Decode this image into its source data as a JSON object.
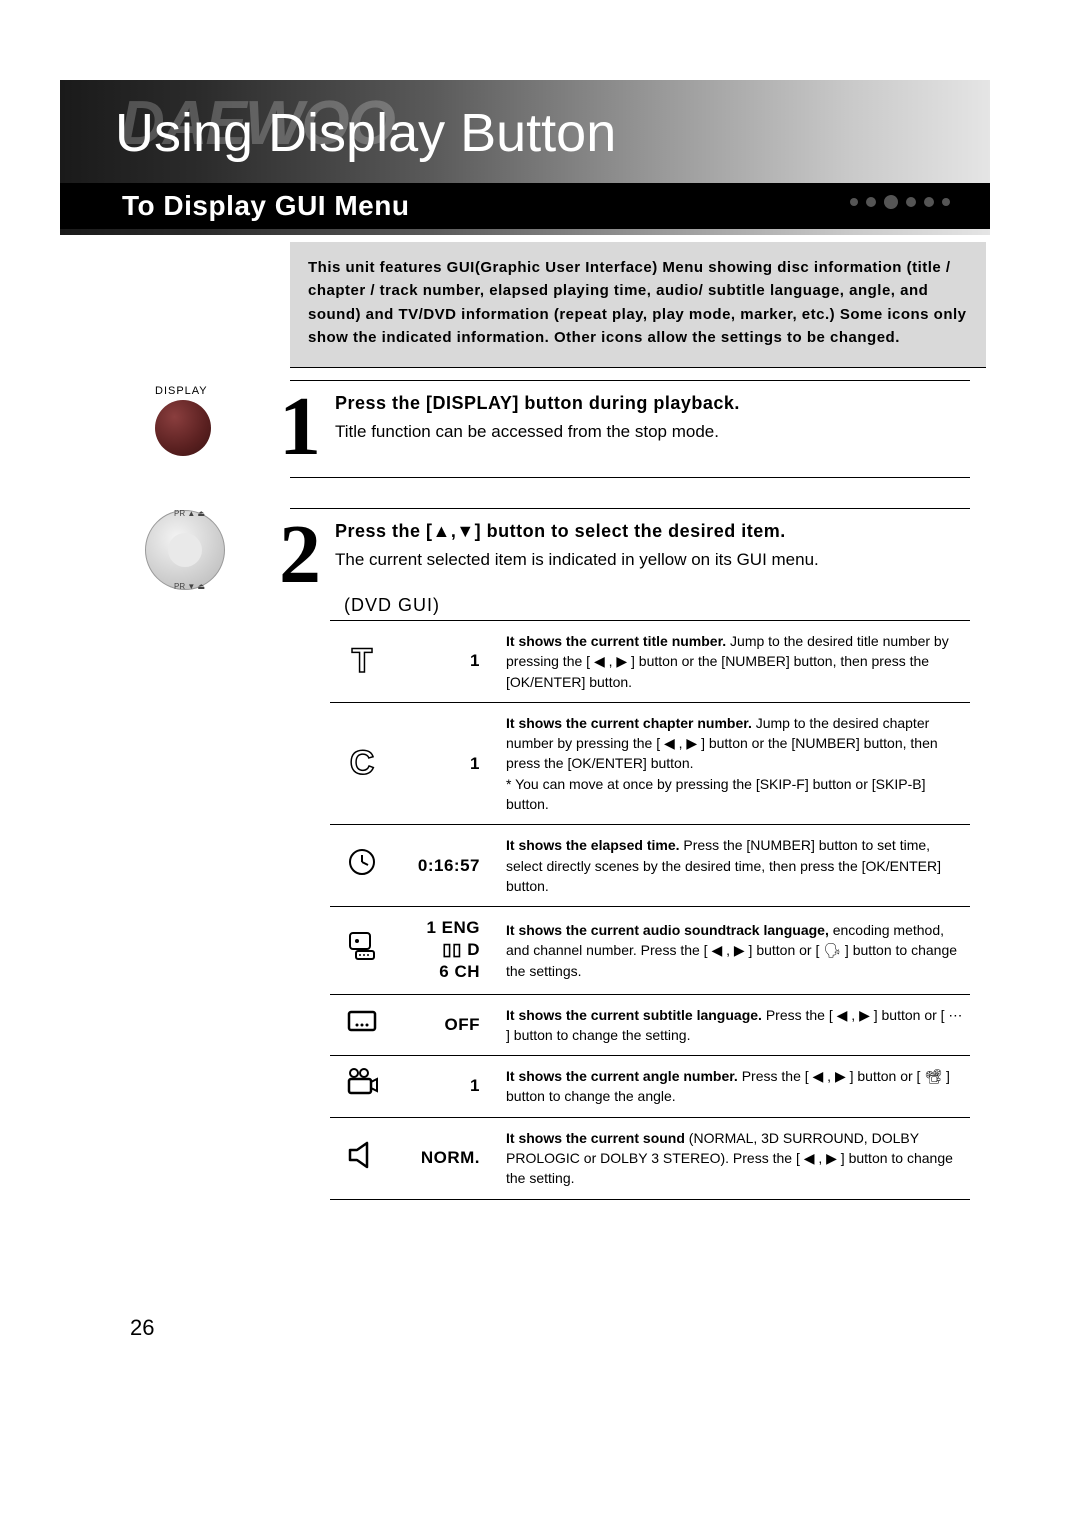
{
  "brand_ghost": "DAEWOO",
  "page_title": "Using Display Button",
  "section_title": "To Display GUI Menu",
  "intro_text": "This unit features GUI(Graphic User Interface) Menu showing disc information (title / chapter / track number, elapsed playing time, audio/ subtitle language, angle, and sound) and TV/DVD information (repeat play, play mode, marker, etc.) Some icons only  show the indicated information. Other icons allow the settings to be changed.",
  "display_label": "DISPLAY",
  "nav_top_label": "PR ▲ ⏏",
  "nav_bottom_label": "PR ▼ ⏏",
  "steps": [
    {
      "num": "1",
      "head": "Press the [DISPLAY] button during playback.",
      "text": "Title function can be accessed from the stop mode."
    },
    {
      "num": "2",
      "head": "Press the [▲,▼] button to select the desired item.",
      "text": "The current selected item is indicated in yellow on its GUI menu."
    }
  ],
  "gui_label": "(DVD GUI)",
  "rows": [
    {
      "icon": "T",
      "value": "1",
      "desc_bold": "It shows the current title number.",
      "desc_rest": " Jump to the desired title number by pressing the [ ◀ , ▶ ] button or the [NUMBER] button, then press the [OK/ENTER] button."
    },
    {
      "icon": "C",
      "value": "1",
      "desc_bold": "It shows the current chapter number.",
      "desc_rest": " Jump to the desired chapter number by pressing the [ ◀ , ▶ ] button or the [NUMBER] button, then press the [OK/ENTER] button.\n* You can move at once by pressing the [SKIP-F] button or [SKIP-B] button."
    },
    {
      "icon": "clock",
      "value": "0:16:57",
      "desc_bold": "It shows the  elapsed time.",
      "desc_rest": " Press the [NUMBER] button to set time, select directly scenes by the desired time, then press the [OK/ENTER] button."
    },
    {
      "icon": "audio",
      "value_lines": [
        "1 ENG",
        "▯▯ D",
        "6 CH"
      ],
      "desc_bold": "It shows the current audio soundtrack language,",
      "desc_rest": " encoding method, and channel number. Press the [ ◀ , ▶ ] button or [ 🗣 ] button to change the settings."
    },
    {
      "icon": "subtitle",
      "value": "OFF",
      "desc_bold": "It shows the current subtitle language.",
      "desc_rest": " Press the [ ◀ , ▶ ] button or [ ⋯ ] button to change the setting."
    },
    {
      "icon": "angle",
      "value": "1",
      "desc_bold": "It shows the current angle number.",
      "desc_rest": " Press the [ ◀ , ▶ ] button or [ 📽 ] button to change the angle."
    },
    {
      "icon": "sound",
      "value": "NORM.",
      "desc_bold": "It shows the current sound",
      "desc_rest": " (NORMAL, 3D SURROUND, DOLBY PROLOGIC or DOLBY 3 STEREO). Press the [ ◀ , ▶ ] button to change the setting."
    }
  ],
  "page_number": "26"
}
